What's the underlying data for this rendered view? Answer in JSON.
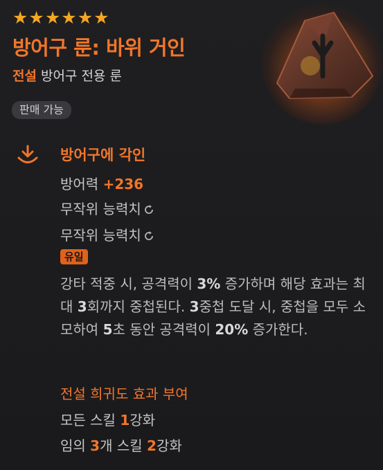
{
  "header": {
    "stars": [
      "★",
      "★",
      "★",
      "★",
      "★",
      "★"
    ],
    "title": "방어구 룬: 바위 거인",
    "grade": "전설",
    "type": "방어구 전용 룬",
    "tradable": "판매 가능"
  },
  "section": {
    "title": "방어구에 각인",
    "defense_label": "방어력 ",
    "defense_plus": "+",
    "defense_value": "236",
    "random_stat_1": "무작위 능력치",
    "random_stat_2": "무작위 능력치",
    "unique_badge": "유일"
  },
  "description": {
    "p1": "강타 적중 시, 공격력이 ",
    "v1": "3%",
    "p2": " 증가하며 해당 효과는 최대 ",
    "v2": "3",
    "p3": "회까지 중첩된다. ",
    "v3": "3",
    "p4": "중첩 도달 시, 중첩을 모두 소모하여 ",
    "v4": "5",
    "p5": "초 동안 공격력이 ",
    "v5": "20%",
    "p6": " 증가한다."
  },
  "bonus": {
    "title": "전설 희귀도 효과 부여",
    "line1_a": "모든 스킬 ",
    "line1_num": "1",
    "line1_b": "강화",
    "line2_a": "임의 ",
    "line2_num1": "3",
    "line2_b": "개 스킬 ",
    "line2_num2": "2",
    "line2_c": "강화"
  },
  "colors": {
    "accent": "#f2762a",
    "star": "#f5a623",
    "background": "#1b1b1d",
    "text": "#c4c4c4",
    "badge_bg": "#e0621a"
  },
  "icons": {
    "section": "download-arrow-icon",
    "reroll": "refresh-icon",
    "item": "rune-stone-icon"
  }
}
